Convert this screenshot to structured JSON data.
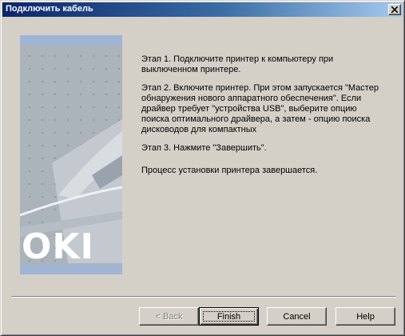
{
  "window": {
    "title": "Подключить кабель",
    "close_symbol": "×"
  },
  "side_panel": {
    "logo_text": "OKI",
    "colors": {
      "band": "#9fb5d6",
      "panel": "#abb3bb"
    },
    "icon": "printer-illustration"
  },
  "content": {
    "step1": "Этап 1. Подключите принтер к компьютеру при выключенном принтере.",
    "step2": "Этап 2. Включите принтер. При этом запускается \"Мастер обнаружения нового аппаратного обеспечения\". Если драйвер требует \"устройства USB\", выберите опцию поиска оптимального драйвера, а затем - опцию поиска дисководов для компактных",
    "step3": "Этап 3. Нажмите \"Завершить\".",
    "status": "Процесс установки принтера завершается."
  },
  "buttons": {
    "back": "< Back",
    "finish": "Finish",
    "cancel": "Cancel",
    "help": "Help"
  }
}
